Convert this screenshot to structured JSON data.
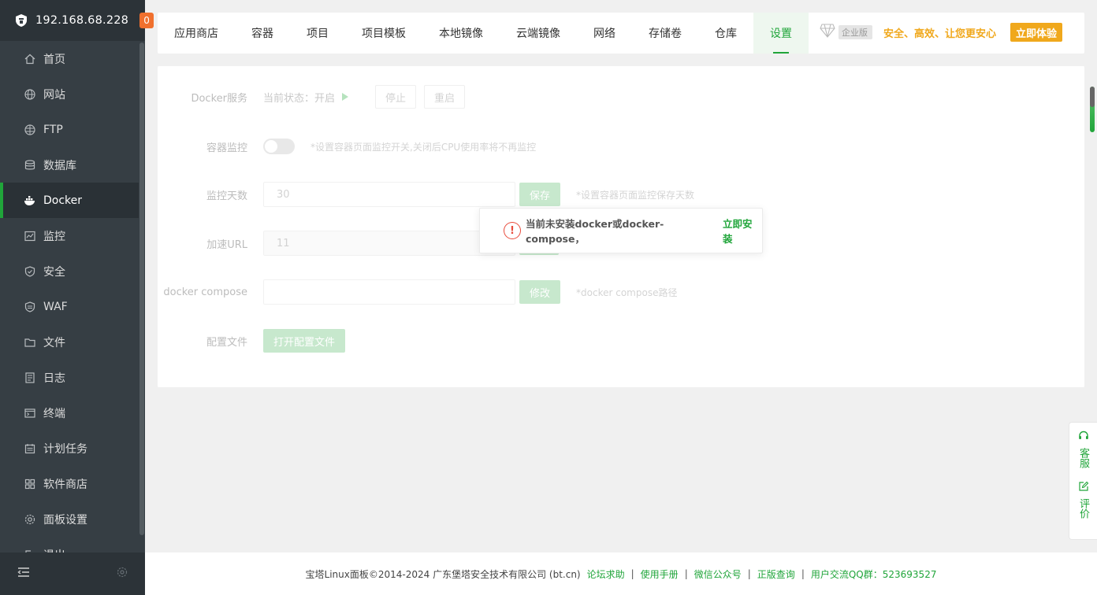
{
  "sidebar": {
    "ip": "192.168.68.228",
    "badge": "0",
    "items": [
      {
        "label": "首页",
        "icon": "home-icon"
      },
      {
        "label": "网站",
        "icon": "globe-icon"
      },
      {
        "label": "FTP",
        "icon": "ftp-icon"
      },
      {
        "label": "数据库",
        "icon": "database-icon"
      },
      {
        "label": "Docker",
        "icon": "docker-icon"
      },
      {
        "label": "监控",
        "icon": "monitor-icon"
      },
      {
        "label": "安全",
        "icon": "shield-icon"
      },
      {
        "label": "WAF",
        "icon": "waf-icon"
      },
      {
        "label": "文件",
        "icon": "folder-icon"
      },
      {
        "label": "日志",
        "icon": "log-icon"
      },
      {
        "label": "终端",
        "icon": "terminal-icon"
      },
      {
        "label": "计划任务",
        "icon": "calendar-icon"
      },
      {
        "label": "软件商店",
        "icon": "grid-icon"
      },
      {
        "label": "面板设置",
        "icon": "gear-icon"
      },
      {
        "label": "退出",
        "icon": "logout-icon"
      }
    ],
    "active_index": 4
  },
  "tabs": [
    {
      "label": "应用商店"
    },
    {
      "label": "容器"
    },
    {
      "label": "项目"
    },
    {
      "label": "项目模板"
    },
    {
      "label": "本地镜像"
    },
    {
      "label": "云端镜像"
    },
    {
      "label": "网络"
    },
    {
      "label": "存储卷"
    },
    {
      "label": "仓库"
    },
    {
      "label": "设置"
    }
  ],
  "promo": {
    "edition": "企业版",
    "slogan": "安全、高效、让您更安心",
    "try_label": "立即体验"
  },
  "settings": {
    "service": {
      "label": "Docker服务",
      "status_prefix": "当前状态：",
      "status_value": "开启",
      "stop_label": "停止",
      "restart_label": "重启"
    },
    "monitor": {
      "label": "容器监控",
      "enabled": false,
      "hint": "*设置容器页面监控开关,关闭后CPU使用率将不再监控"
    },
    "days": {
      "label": "监控天数",
      "value": "30",
      "save_label": "保存",
      "hint": "*设置容器页面监控保存天数"
    },
    "mirror": {
      "label": "加速URL",
      "value": "11"
    },
    "compose": {
      "label": "docker compose",
      "value": "",
      "modify_label": "修改",
      "hint": "*docker compose路径"
    },
    "config": {
      "label": "配置文件",
      "open_label": "打开配置文件"
    }
  },
  "message": {
    "text": "当前未安装docker或docker-compose，",
    "link": "立即安装"
  },
  "float_help": {
    "service": "客服",
    "review": "评价"
  },
  "footer": {
    "copyright": "宝塔Linux面板©2014-2024 广东堡塔安全技术有限公司 (bt.cn)",
    "links": [
      "论坛求助",
      "使用手册",
      "微信公众号",
      "正版查询"
    ],
    "qq": "用户交流QQ群：523693527"
  },
  "colors": {
    "brand_green": "#20a53a",
    "sidebar_bg": "#363e44",
    "badge_orange": "#f0702e",
    "promo_gold": "#f0a81c",
    "warn_red": "#e84b3c"
  }
}
